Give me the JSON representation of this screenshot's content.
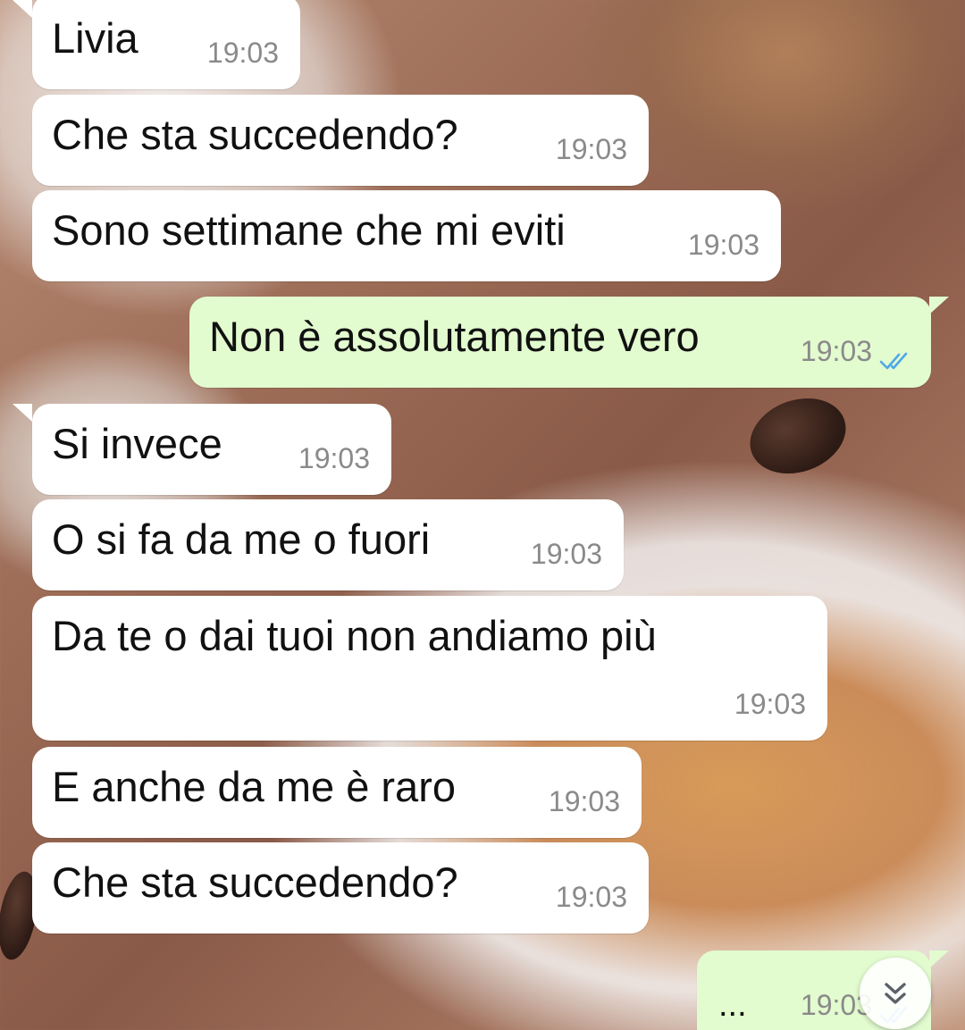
{
  "messages": [
    {
      "direction": "in",
      "text": "Livia",
      "time": "19:03"
    },
    {
      "direction": "in",
      "text": "Che sta succedendo?",
      "time": "19:03"
    },
    {
      "direction": "in",
      "text": "Sono settimane che mi eviti",
      "time": "19:03"
    },
    {
      "direction": "out",
      "text": "Non è assolutamente vero",
      "time": "19:03",
      "status": "read"
    },
    {
      "direction": "in",
      "text": "Si invece",
      "time": "19:03"
    },
    {
      "direction": "in",
      "text": "O si fa da me o fuori",
      "time": "19:03"
    },
    {
      "direction": "in",
      "text": "Da te o dai tuoi non andiamo più",
      "time": "19:03"
    },
    {
      "direction": "in",
      "text": "E anche da me è raro",
      "time": "19:03"
    },
    {
      "direction": "in",
      "text": "Che sta succedendo?",
      "time": "19:03"
    },
    {
      "direction": "out",
      "text": "...",
      "time": "19:03",
      "status": "read"
    }
  ],
  "colors": {
    "incoming_bubble": "#ffffff",
    "outgoing_bubble": "#e2fbcf",
    "read_ticks": "#4fa8e8",
    "timestamp": "#8a8a8a"
  },
  "icons": {
    "read_receipt": "double-check-icon",
    "scroll_down": "double-chevron-down-icon"
  }
}
